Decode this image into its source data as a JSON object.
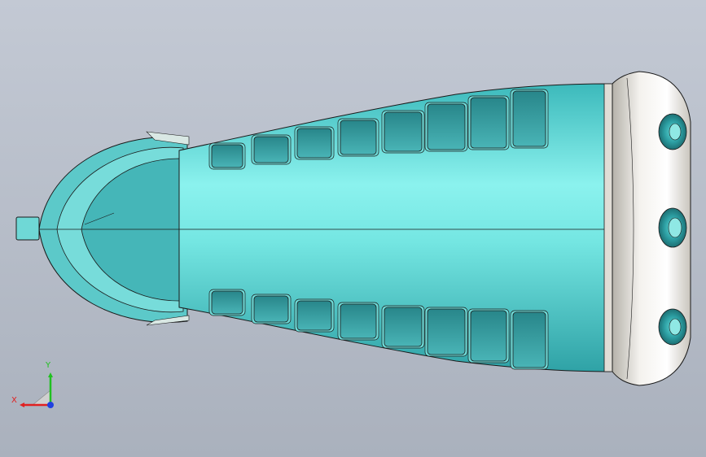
{
  "viewport": {
    "background_top": "#c3c9d4",
    "background_bottom": "#aab1bd"
  },
  "model": {
    "body_color": "#56d0cf",
    "body_highlight": "#8bf2ee",
    "groove_color": "#2f9094",
    "cap_color": "#e8e4de",
    "edge_color": "#1a1a1a"
  },
  "triad": {
    "x_label": "X",
    "y_label": "Y",
    "x_color": "#e02020",
    "y_color": "#20c020",
    "z_color": "#2040e0"
  }
}
